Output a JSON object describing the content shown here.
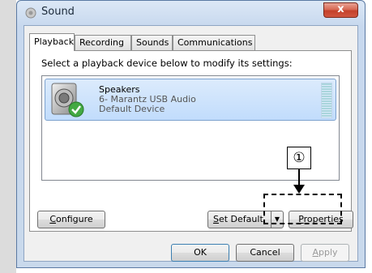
{
  "window": {
    "title": "Sound",
    "close_label": "x"
  },
  "tabs": [
    {
      "label": "Playback",
      "active": true
    },
    {
      "label": "Recording",
      "active": false
    },
    {
      "label": "Sounds",
      "active": false
    },
    {
      "label": "Communications",
      "active": false
    }
  ],
  "playback": {
    "instruction": "Select a playback device below to modify its settings:",
    "device": {
      "name": "Speakers",
      "description": "6- Marantz USB Audio",
      "status": "Default Device"
    }
  },
  "buttons": {
    "configure": {
      "accel": "C",
      "rest": "onfigure"
    },
    "set_default": {
      "accel": "S",
      "rest": "et Default"
    },
    "properties": {
      "accel": "P",
      "rest": "roperties"
    },
    "ok": "OK",
    "cancel": "Cancel",
    "apply": {
      "accel": "A",
      "rest": "pply"
    }
  },
  "callout": {
    "number": "①"
  },
  "icons": [
    "sound-app-icon",
    "speaker-icon",
    "checkmark-icon",
    "close-icon",
    "dropdown-arrow-icon",
    "level-meter"
  ]
}
